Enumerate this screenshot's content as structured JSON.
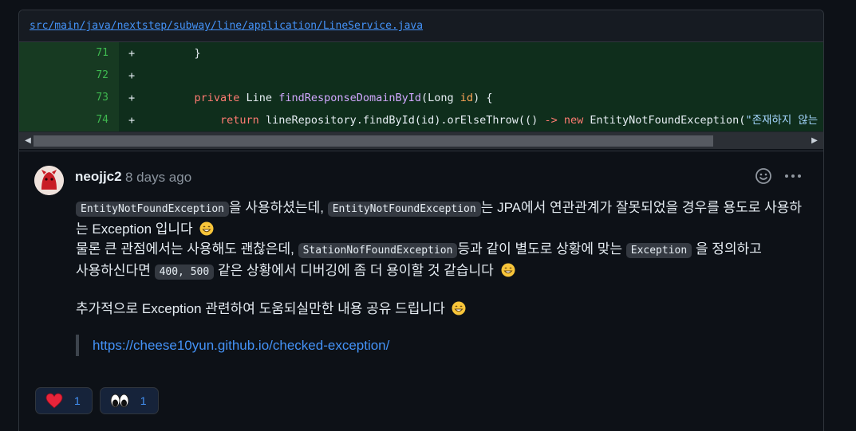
{
  "file": {
    "path": "src/main/java/nextstep/subway/line/application/LineService.java"
  },
  "code_lines": [
    {
      "number": "71",
      "marker": "+",
      "code": "    }"
    },
    {
      "number": "72",
      "marker": "+",
      "code": ""
    },
    {
      "number": "73",
      "marker": "+",
      "code": "    private Line findResponseDomainById(Long id) {"
    },
    {
      "number": "74",
      "marker": "+",
      "code": "        return lineRepository.findById(id).orElseThrow(() -> new EntityNotFoundException(\"존재하지 않는"
    }
  ],
  "comment": {
    "author": "neojjc2",
    "time": "8 days ago",
    "p1": {
      "code1": "EntityNotFoundException",
      "text1": "을 사용하셨는데,",
      "code2": "EntityNotFoundException",
      "text2": "는 JPA에서 연관관계가 잘못되었을 경우를 용도로 사용하는 Exception 입니다"
    },
    "p2": {
      "text1": "물론 큰 관점에서는 사용해도 괜찮은데,",
      "code1": "StationNofFoundException",
      "text2": "등과 같이 별도로 상황에 맞는",
      "code2": "Exception",
      "text3": "을 정의하고"
    },
    "p3": {
      "text1": "사용하신다면",
      "code1": "400, 500",
      "text2": "같은 상황에서 디버깅에 좀 더 용이할 것 같습니다"
    },
    "p4": {
      "text1": "추가적으로 Exception 관련하여 도움되실만한 내용 공유 드립니다"
    },
    "quote_link": "https://cheese10yun.github.io/checked-exception/"
  },
  "reactions": [
    {
      "icon": "heart-icon",
      "count": "1"
    },
    {
      "icon": "eyes-icon",
      "count": "1"
    }
  ]
}
